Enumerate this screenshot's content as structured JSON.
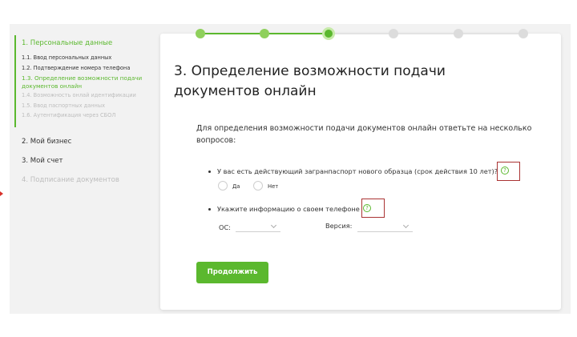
{
  "sidebar": {
    "section_title": "1. Персональные данные",
    "subitems": [
      {
        "label": "1.1. Ввод персональных данных",
        "state": "done"
      },
      {
        "label": "1.2. Подтверждение номера телефона",
        "state": "done"
      },
      {
        "label": "1.3. Определение возможности подачи документов онлайн",
        "state": "active"
      },
      {
        "label": "1.4. Возможность онлай идентификации",
        "state": "muted"
      },
      {
        "label": "1.5. Ввод паспортных данных",
        "state": "muted"
      },
      {
        "label": "1.6. Аутентификация через СБОЛ",
        "state": "muted"
      }
    ],
    "items": [
      {
        "label": "2. Мой бизнес",
        "state": "normal"
      },
      {
        "label": "3. Мой счет",
        "state": "normal"
      },
      {
        "label": "4. Подписание документов",
        "state": "muted"
      }
    ]
  },
  "stepper": {
    "total": 6,
    "current": 3,
    "colors": {
      "done": "#8fd05c",
      "current": "#5bb82e",
      "future": "#dcdcdc"
    }
  },
  "main": {
    "title": "3.  Определение возможности подачи документов онлайн",
    "intro": "Для определения возможности подачи документов онлайн ответьте на несколько вопросов:",
    "question1": {
      "text": "У вас есть действующий загранпаспорт нового образца (срок действия 10 лет)?",
      "help_icon": "question-circle-icon",
      "options": [
        "Да",
        "Нет"
      ]
    },
    "question2": {
      "text": "Укажите информацию о своем телефоне",
      "help_icon": "question-circle-icon",
      "os_label": "ОС:",
      "os_value": "",
      "version_label": "Версия:",
      "version_value": ""
    },
    "continue_label": "Продолжить"
  },
  "colors": {
    "accent": "#5bb82e",
    "annotation": "#a33333"
  }
}
